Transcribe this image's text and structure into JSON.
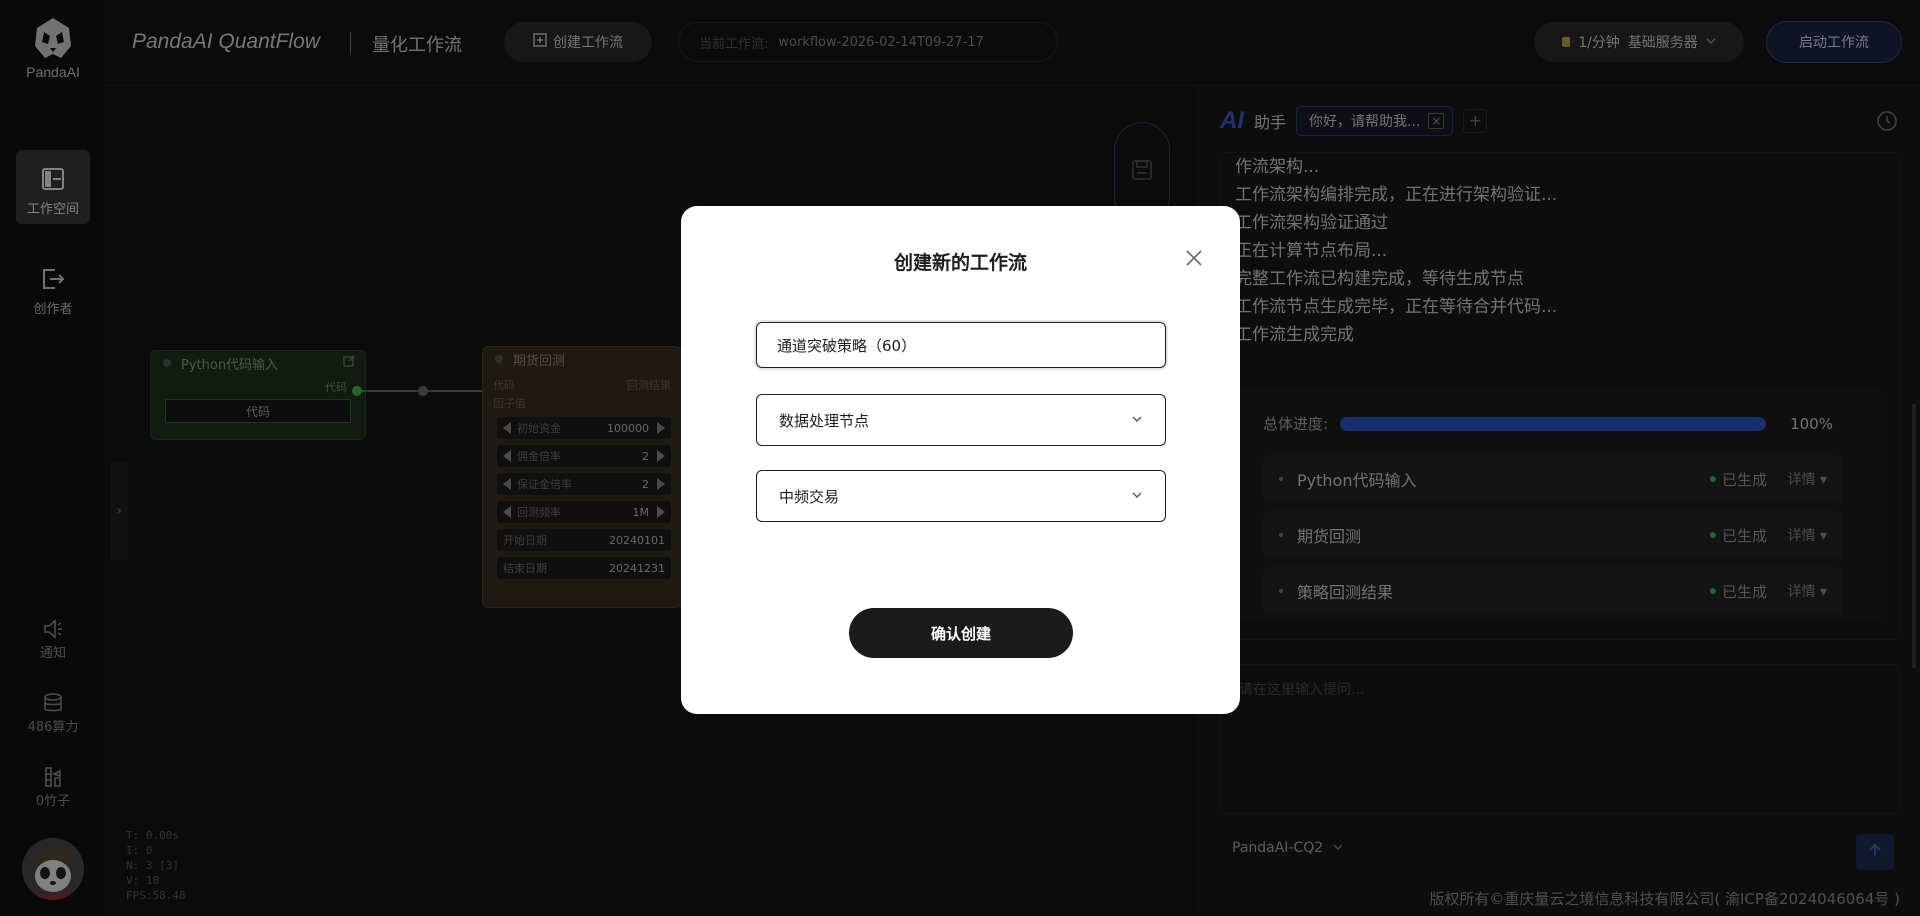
{
  "sidebar": {
    "brand": "PandaAI",
    "items": [
      {
        "label": "工作空间",
        "active": true
      },
      {
        "label": "创作者",
        "active": false
      }
    ],
    "notifications_label": "通知",
    "compute_label": "486算力",
    "bamboo_label": "0竹子"
  },
  "header": {
    "app_title": "PandaAI QuantFlow",
    "subtitle": "量化工作流",
    "create_button": "创建工作流",
    "current_workflow_label": "当前工作流:",
    "current_workflow_value": "workflow-2026-02-14T09-27-17",
    "rate_label": "1/分钟",
    "server_label": "基础服务器",
    "start_button": "启动工作流"
  },
  "canvas": {
    "python_node": {
      "title": "Python代码输入",
      "out_port": "代码",
      "field": "代码"
    },
    "futures_node": {
      "title": "期货回测",
      "in_port": "代码",
      "out_port": "回测结果",
      "sub_port": "因子值",
      "params": [
        {
          "label": "初始资金",
          "value": "100000",
          "stepper": true
        },
        {
          "label": "佣金倍率",
          "value": "2",
          "stepper": true
        },
        {
          "label": "保证金倍率",
          "value": "2",
          "stepper": true
        },
        {
          "label": "回测频率",
          "value": "1M",
          "stepper": true
        },
        {
          "label": "开始日期",
          "value": "20240101",
          "stepper": false
        },
        {
          "label": "结束日期",
          "value": "20241231",
          "stepper": false
        }
      ]
    },
    "stats": [
      "T: 0.00s",
      "I: 0",
      "N: 3 [3]",
      "V: 18",
      "FPS:58.48"
    ]
  },
  "ai_panel": {
    "logo": "AI",
    "title": "助手",
    "chat_tab": "你好，请帮助我...",
    "log_lines": [
      "作流架构...",
      "工作流架构编排完成，正在进行架构验证...",
      "工作流架构验证通过",
      "正在计算节点布局...",
      "完整工作流已构建完成，等待生成节点",
      "工作流节点生成完毕，正在等待合并代码...",
      "工作流生成完成"
    ],
    "progress_label": "总体进度:",
    "progress_value": 1.0,
    "progress_text": "100%",
    "steps": [
      {
        "name": "Python代码输入",
        "status": "已生成",
        "detail": "详情 ▾"
      },
      {
        "name": "期货回测",
        "status": "已生成",
        "detail": "详情 ▾"
      },
      {
        "name": "策略回测结果",
        "status": "已生成",
        "detail": "详情 ▾"
      }
    ],
    "prompt_placeholder": "请在这里输入提问...",
    "model": "PandaAI-CQ2"
  },
  "footer": "版权所有©重庆量云之境信息科技有限公司( 渝ICP备2024046064号 )",
  "modal": {
    "title": "创建新的工作流",
    "name_value": "通道突破策略（60）",
    "type_select": "数据处理节点",
    "freq_select": "中频交易",
    "confirm_button": "确认创建"
  },
  "colors": {
    "accent_blue": "#2a56c2",
    "success_green": "#3fbb4a",
    "python_node": "#1f3320",
    "futures_node": "#3a2f1f"
  }
}
